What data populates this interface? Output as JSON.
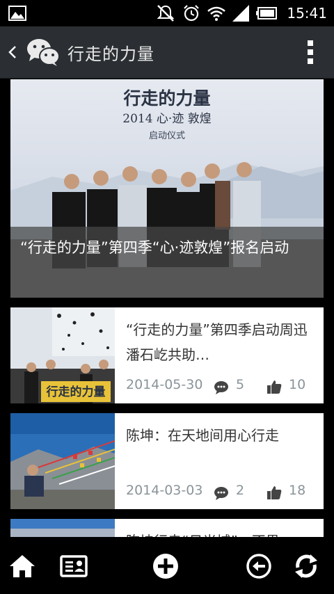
{
  "status_bar": {
    "time": "15:41",
    "icons": [
      "gallery-icon",
      "mute-icon",
      "alarm-icon",
      "wifi-icon",
      "signal-icon",
      "battery-icon"
    ]
  },
  "header": {
    "title": "行走的力量",
    "back_icon": "chevron-left-icon",
    "logo_icon": "wechat-icon",
    "menu_icon": "overflow-menu-icon"
  },
  "featured": {
    "title": "“行走的力量”第四季“心·迹敦煌”报名启动",
    "photo": {
      "brand": "行走的力量",
      "line": "2014 心·迹 敦煌",
      "caption": "启动仪式"
    }
  },
  "articles": [
    {
      "title": "“行走的力量”第四季启动周迅潘石屹共助…",
      "date": "2014-05-30",
      "comments": "5",
      "likes": "10",
      "thumb_sign": "行走的力量"
    },
    {
      "title": "陈坤：在天地间用心行走",
      "date": "2014-03-03",
      "comments": "2",
      "likes": "18"
    },
    {
      "title": "陈坤行走“日光城”，不畏"
    }
  ],
  "bottom_bar": {
    "buttons": [
      "home-icon",
      "article-card-icon",
      "add-icon",
      "back-circle-icon",
      "refresh-icon"
    ]
  },
  "colors": {
    "header_bg": "#2b2f33",
    "card_bg": "#ffffff",
    "meta_text": "#8a9499",
    "overlay": "#464646"
  }
}
